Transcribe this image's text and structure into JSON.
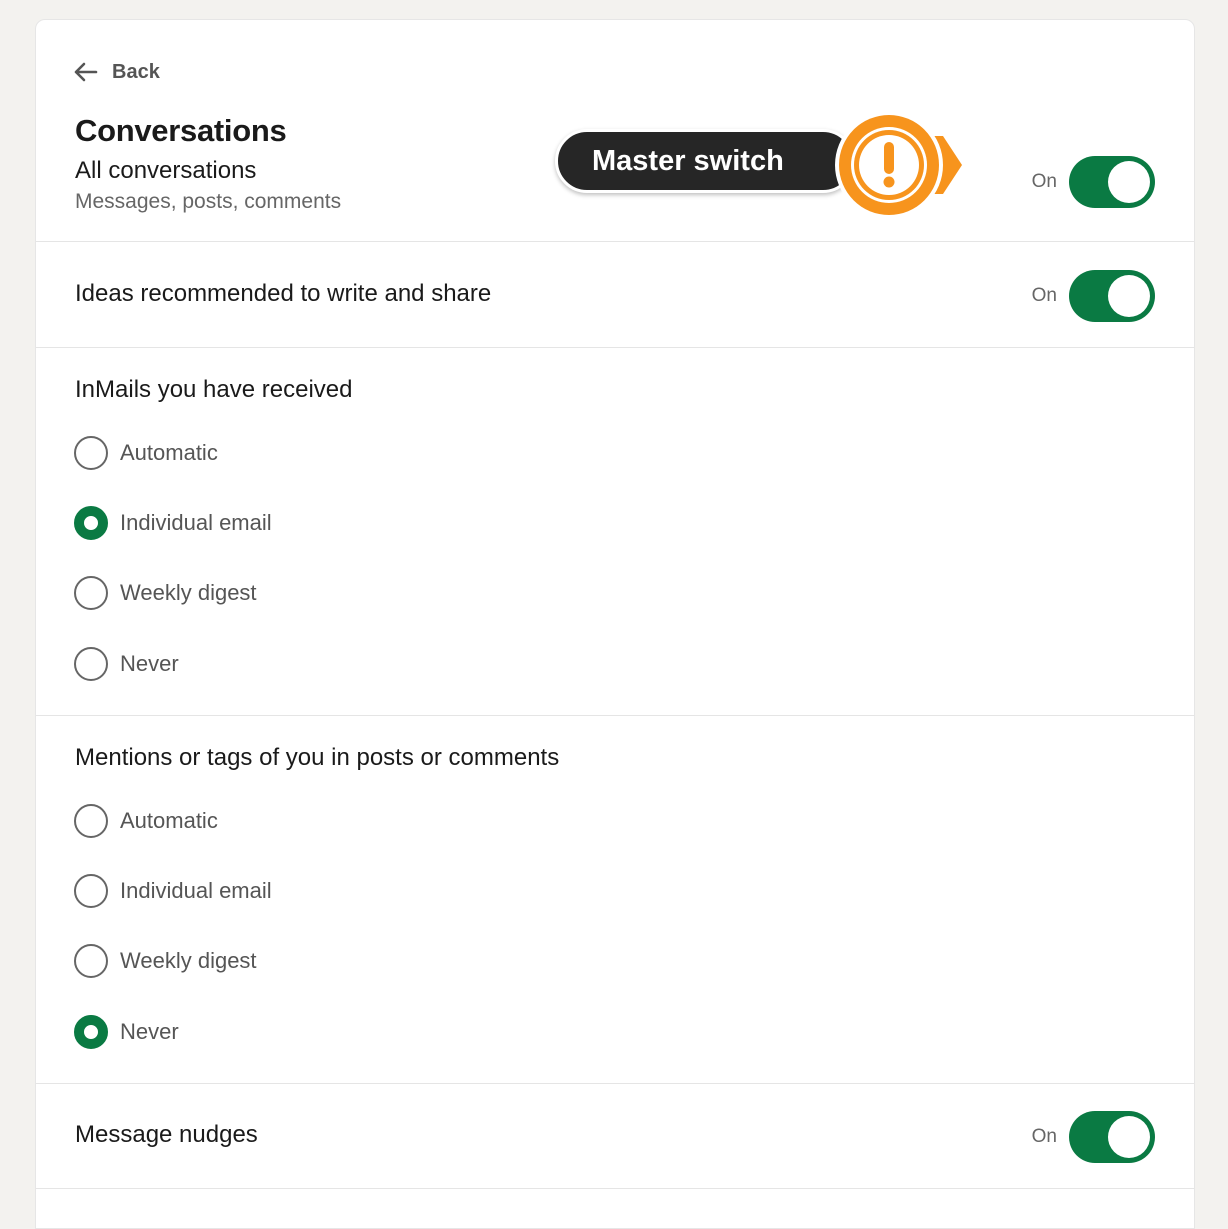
{
  "header": {
    "back_label": "Back",
    "title": "Conversations",
    "subtitle": "All conversations",
    "caption": "Messages, posts, comments",
    "toggle_state": "On"
  },
  "annotation": {
    "label": "Master switch",
    "badge_symbol": "!",
    "color": "#f7941d"
  },
  "ideas": {
    "label": "Ideas recommended to write and share",
    "toggle_state": "On"
  },
  "inmails": {
    "title": "InMails you have received",
    "options": [
      {
        "label": "Automatic",
        "selected": false
      },
      {
        "label": "Individual email",
        "selected": true
      },
      {
        "label": "Weekly digest",
        "selected": false
      },
      {
        "label": "Never",
        "selected": false
      }
    ]
  },
  "mentions": {
    "title": "Mentions or tags of you in posts or comments",
    "options": [
      {
        "label": "Automatic",
        "selected": false
      },
      {
        "label": "Individual email",
        "selected": false
      },
      {
        "label": "Weekly digest",
        "selected": false
      },
      {
        "label": "Never",
        "selected": true
      }
    ]
  },
  "nudges": {
    "label": "Message nudges",
    "toggle_state": "On"
  },
  "colors": {
    "accent": "#0a7a43",
    "background": "#f3f2ef",
    "annotation": "#f7941d"
  }
}
